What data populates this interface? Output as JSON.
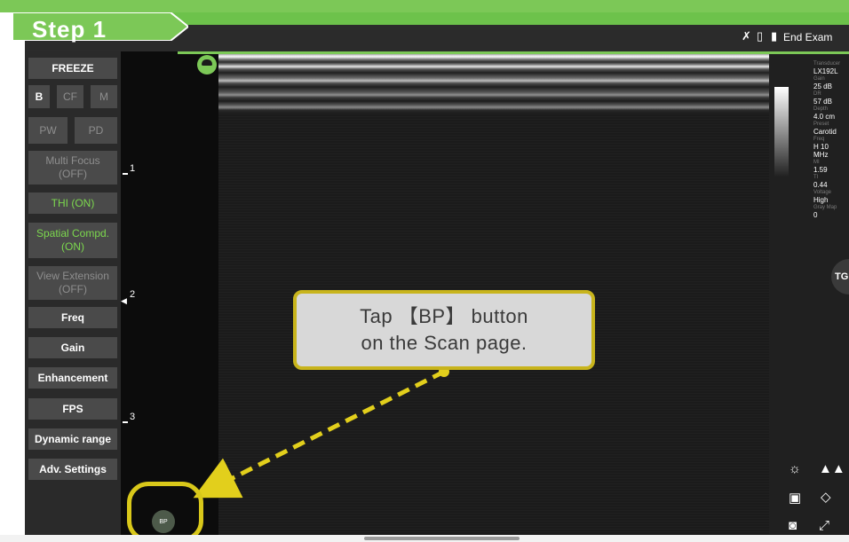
{
  "step": {
    "label": "Step 1"
  },
  "status_bar": {
    "end_exam_label": "End Exam"
  },
  "left_panel": {
    "freeze": "FREEZE",
    "mode_b": "B",
    "mode_cf": "CF",
    "mode_m": "M",
    "mode_pw": "PW",
    "mode_pd": "PD",
    "multi_focus": "Multi Focus\n(OFF)",
    "thi": "THI (ON)",
    "spatial_compd": "Spatial Compd.\n(ON)",
    "view_extension": "View Extension\n(OFF)",
    "freq": "Freq",
    "gain": "Gain",
    "enhancement": "Enhancement",
    "fps": "FPS",
    "dynamic_range": "Dynamic range",
    "adv_settings": "Adv. Settings"
  },
  "depth_marks": [
    "1",
    "2",
    "3"
  ],
  "info_panel": {
    "transducer_label": "Transducer",
    "transducer": "LX192L",
    "gain_label": "Gain",
    "gain": "25 dB",
    "dr_label": "DR",
    "dr": "57 dB",
    "depth_label": "Depth",
    "depth": "4.0 cm",
    "preset_label": "Preset",
    "preset": "Carotid",
    "freq_label": "Freq",
    "freq": "H 10\nMHz",
    "mi_label": "MI",
    "mi": "1.59",
    "ti_label": "TI",
    "ti": "0.44",
    "voltage_label": "Voltage",
    "voltage": "High",
    "gray_map_label": "Gray Map",
    "gray_map": "0"
  },
  "tg_button": "TG",
  "callout": {
    "line1": "Tap 【BP】 button",
    "line2": "on the Scan page."
  },
  "bp_button": "BP",
  "colors": {
    "accent_green": "#7cc857",
    "highlight_yellow": "#d9c81a",
    "panel_button": "#4a4a4a"
  }
}
